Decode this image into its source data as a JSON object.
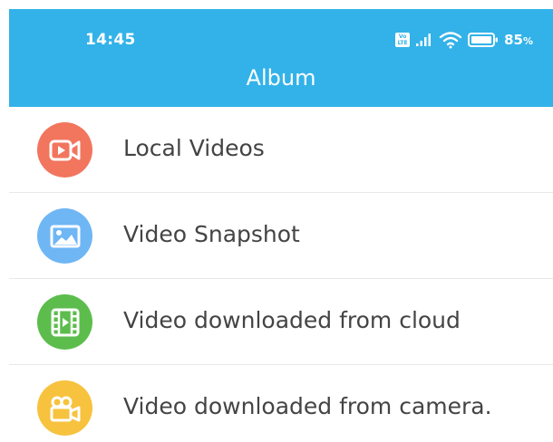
{
  "status_bar": {
    "time": "14:45",
    "volte_top": "Vo",
    "volte_bottom": "LTE",
    "battery_percent": "85",
    "battery_unit": "%",
    "icons": [
      "volte-icon",
      "signal-icon",
      "wifi-icon",
      "battery-icon"
    ]
  },
  "header": {
    "title": "Album",
    "background_color": "#32b2e8"
  },
  "menu": {
    "items": [
      {
        "label": "Local Videos",
        "icon": "video-camera-icon",
        "color": "#f2755e"
      },
      {
        "label": "Video Snapshot",
        "icon": "image-icon",
        "color": "#6fb6f5"
      },
      {
        "label": "Video downloaded from cloud",
        "icon": "film-strip-icon",
        "color": "#5cbd4c"
      },
      {
        "label": "Video downloaded from camera.",
        "icon": "movie-camera-icon",
        "color": "#f7c23e"
      }
    ]
  }
}
